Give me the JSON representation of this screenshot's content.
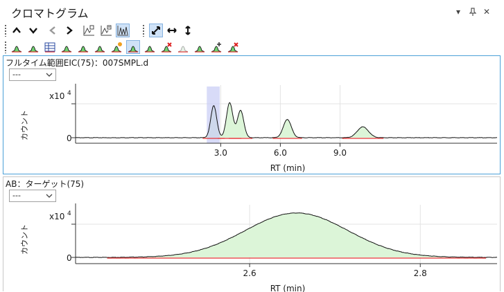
{
  "window": {
    "title": "クロマトグラム",
    "pin_glyph": "▾",
    "close_glyph": "✕"
  },
  "toolbar1": {
    "buttons": [
      {
        "icon": "chevron-up-icon"
      },
      {
        "icon": "chevron-down-icon"
      },
      {
        "icon": "chevron-left-icon"
      },
      {
        "icon": "chevron-right-icon"
      },
      {
        "icon": "overlay-up-icon"
      },
      {
        "icon": "overlay-down-icon"
      },
      {
        "icon": "overlay-all-icon",
        "active": true
      },
      {
        "icon": "autoscale-icon",
        "active": true
      },
      {
        "icon": "autoscale-x-icon"
      },
      {
        "icon": "autoscale-y-icon"
      }
    ]
  },
  "toolbar2": {
    "buttons": [
      {
        "icon": "integrate-icon"
      },
      {
        "icon": "integrate-all-icon"
      },
      {
        "icon": "table-icon"
      },
      {
        "icon": "peak-label-icon"
      },
      {
        "icon": "peak-grid-icon"
      },
      {
        "icon": "peak-edit-icon"
      },
      {
        "icon": "peak-info-icon"
      },
      {
        "icon": "peak-active-icon",
        "active": true
      },
      {
        "icon": "peak-search-icon"
      },
      {
        "icon": "peak-remove-icon"
      },
      {
        "icon": "peak-disabled-icon"
      },
      {
        "icon": "peak-split-icon"
      },
      {
        "icon": "peak-add-icon"
      },
      {
        "icon": "peak-delete-icon"
      }
    ]
  },
  "colors": {
    "peak_fill": "#dcf5d8",
    "baseline": "#e23030",
    "selection": "#c8ccf5",
    "panel_border_active": "#4aa0d8"
  },
  "panels": [
    {
      "title": "フルタイム範囲EIC(75)：007SMPL.d",
      "dropdown": "---",
      "ylabel": "カウント",
      "exponent_base": "x10",
      "exponent": "4",
      "y_zero": "0",
      "xlabel": "RT (min)"
    },
    {
      "title": "AB：ターゲット(75)",
      "dropdown": "---",
      "ylabel": "カウント",
      "exponent_base": "x10",
      "exponent": "4",
      "y_zero": "0",
      "xlabel": "RT (min)"
    }
  ],
  "chart_data": [
    {
      "type": "line",
      "xlabel": "RT (min)",
      "ylabel": "カウント",
      "xlim": [
        -4.3,
        16.9
      ],
      "ylim": [
        0,
        1.0
      ],
      "xticks": [
        "3.0",
        "6.0",
        "9.0"
      ],
      "xtick_values": [
        3.0,
        6.0,
        9.0
      ],
      "selection_range": [
        2.3,
        2.95
      ],
      "peaks": [
        {
          "rt": 2.65,
          "height": 0.68,
          "width": 0.15
        },
        {
          "rt": 3.45,
          "height": 0.74,
          "width": 0.16
        },
        {
          "rt": 4.0,
          "height": 0.58,
          "width": 0.16
        },
        {
          "rt": 6.35,
          "height": 0.39,
          "width": 0.2
        },
        {
          "rt": 10.15,
          "height": 0.23,
          "width": 0.28
        }
      ]
    },
    {
      "type": "line",
      "xlabel": "RT (min)",
      "ylabel": "カウント",
      "xlim": [
        2.396,
        2.89
      ],
      "ylim": [
        0,
        0.9
      ],
      "xticks": [
        "2.6",
        "2.8"
      ],
      "xtick_values": [
        2.6,
        2.8
      ],
      "peaks": [
        {
          "rt": 2.655,
          "height": 0.85,
          "width": 0.06
        }
      ]
    }
  ]
}
